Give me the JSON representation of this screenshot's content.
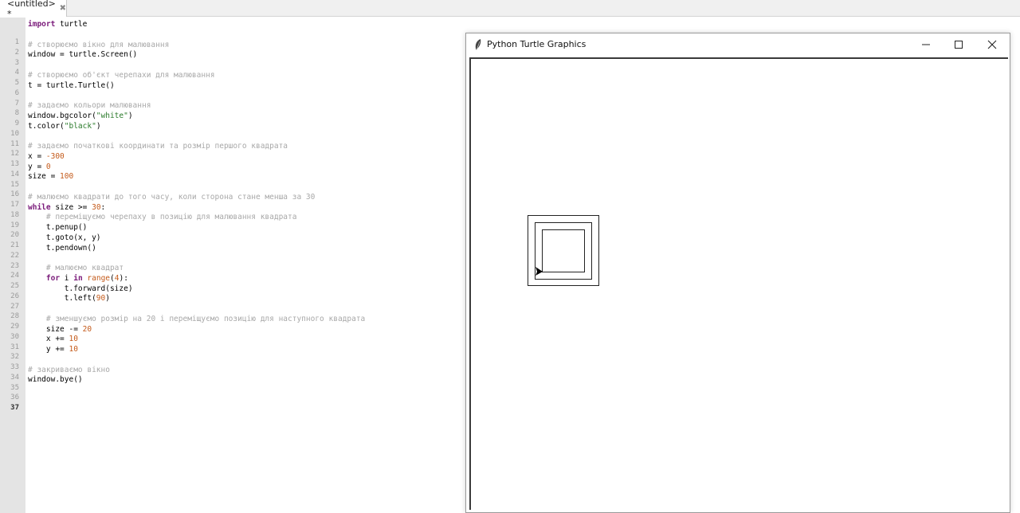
{
  "tab": {
    "label": "<untitled> *",
    "close_glyph": "✖"
  },
  "editor": {
    "current_line": 37,
    "lines": [
      [
        {
          "t": "import",
          "c": "kw"
        },
        {
          "t": " turtle"
        }
      ],
      [],
      [
        {
          "t": "# створюємо вікно для малювання",
          "c": "cm"
        }
      ],
      [
        {
          "t": "window = turtle.Screen()"
        }
      ],
      [],
      [
        {
          "t": "# створюємо об'єкт черепахи для малювання",
          "c": "cm"
        }
      ],
      [
        {
          "t": "t = turtle.Turtle()"
        }
      ],
      [],
      [
        {
          "t": "# задаємо кольори малювання",
          "c": "cm"
        }
      ],
      [
        {
          "t": "window.bgcolor("
        },
        {
          "t": "\"white\"",
          "c": "st"
        },
        {
          "t": ")"
        }
      ],
      [
        {
          "t": "t.color("
        },
        {
          "t": "\"black\"",
          "c": "st"
        },
        {
          "t": ")"
        }
      ],
      [],
      [
        {
          "t": "# задаємо початкові координати та розмір першого квадрата",
          "c": "cm"
        }
      ],
      [
        {
          "t": "x = "
        },
        {
          "t": "-300",
          "c": "nm"
        }
      ],
      [
        {
          "t": "y = "
        },
        {
          "t": "0",
          "c": "nm"
        }
      ],
      [
        {
          "t": "size = "
        },
        {
          "t": "100",
          "c": "nm"
        }
      ],
      [],
      [
        {
          "t": "# малюємо квадрати до того часу, коли сторона стане менша за 30",
          "c": "cm"
        }
      ],
      [
        {
          "t": "while",
          "c": "kw"
        },
        {
          "t": " size >= "
        },
        {
          "t": "30",
          "c": "nm"
        },
        {
          "t": ":"
        }
      ],
      [
        {
          "t": "    "
        },
        {
          "t": "# переміщуємо черепаху в позицію для малювання квадрата",
          "c": "cm"
        }
      ],
      [
        {
          "t": "    t.penup()"
        }
      ],
      [
        {
          "t": "    t.goto(x, y)"
        }
      ],
      [
        {
          "t": "    t.pendown()"
        }
      ],
      [],
      [
        {
          "t": "    "
        },
        {
          "t": "# малюємо квадрат",
          "c": "cm"
        }
      ],
      [
        {
          "t": "    "
        },
        {
          "t": "for",
          "c": "kw"
        },
        {
          "t": " i "
        },
        {
          "t": "in",
          "c": "kw"
        },
        {
          "t": " "
        },
        {
          "t": "range",
          "c": "nm"
        },
        {
          "t": "("
        },
        {
          "t": "4",
          "c": "nm"
        },
        {
          "t": "):"
        }
      ],
      [
        {
          "t": "        t.forward(size)"
        }
      ],
      [
        {
          "t": "        t.left("
        },
        {
          "t": "90",
          "c": "nm"
        },
        {
          "t": ")"
        }
      ],
      [],
      [
        {
          "t": "    "
        },
        {
          "t": "# зменшуємо розмір на 20 і переміщуємо позицію для наступного квадрата",
          "c": "cm"
        }
      ],
      [
        {
          "t": "    size -= "
        },
        {
          "t": "20",
          "c": "nm"
        }
      ],
      [
        {
          "t": "    x += "
        },
        {
          "t": "10",
          "c": "nm"
        }
      ],
      [
        {
          "t": "    y += "
        },
        {
          "t": "10",
          "c": "nm"
        }
      ],
      [],
      [
        {
          "t": "# закриваємо вікно",
          "c": "cm"
        }
      ],
      [
        {
          "t": "window.bye()"
        }
      ],
      []
    ]
  },
  "turtle_window": {
    "title": "Python Turtle Graphics",
    "icon": "feather-icon",
    "controls": [
      "minimize-icon",
      "maximize-icon",
      "close-icon"
    ]
  }
}
